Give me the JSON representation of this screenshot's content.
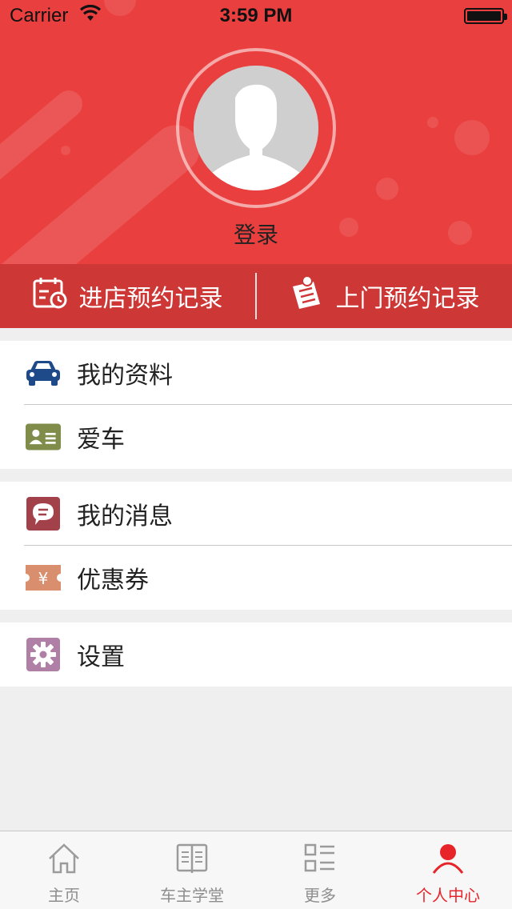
{
  "status_bar": {
    "carrier": "Carrier",
    "time": "3:59 PM"
  },
  "profile": {
    "login_label": "登录"
  },
  "records": {
    "store_booking": "进店预约记录",
    "home_booking": "上门预约记录"
  },
  "groups": [
    {
      "items": [
        {
          "label": "我的资料",
          "icon": "car-icon",
          "color": "#1f4a8a"
        },
        {
          "label": "爱车",
          "icon": "id-card-icon",
          "color": "#7f8c4a"
        }
      ]
    },
    {
      "items": [
        {
          "label": "我的消息",
          "icon": "message-icon",
          "color": "#a3414a"
        },
        {
          "label": "优惠券",
          "icon": "coupon-icon",
          "color": "#d98f6d"
        }
      ]
    },
    {
      "items": [
        {
          "label": "设置",
          "icon": "gear-icon",
          "color": "#b07fa6"
        }
      ]
    }
  ],
  "tabbar": {
    "tabs": [
      {
        "label": "主页",
        "icon": "home-icon"
      },
      {
        "label": "车主学堂",
        "icon": "book-icon"
      },
      {
        "label": "更多",
        "icon": "grid-list-icon"
      },
      {
        "label": "个人中心",
        "icon": "person-icon",
        "active": true
      }
    ]
  },
  "colors": {
    "header": "#e9403f",
    "record_bar": "#cd3736",
    "active_tab": "#e8242b"
  }
}
